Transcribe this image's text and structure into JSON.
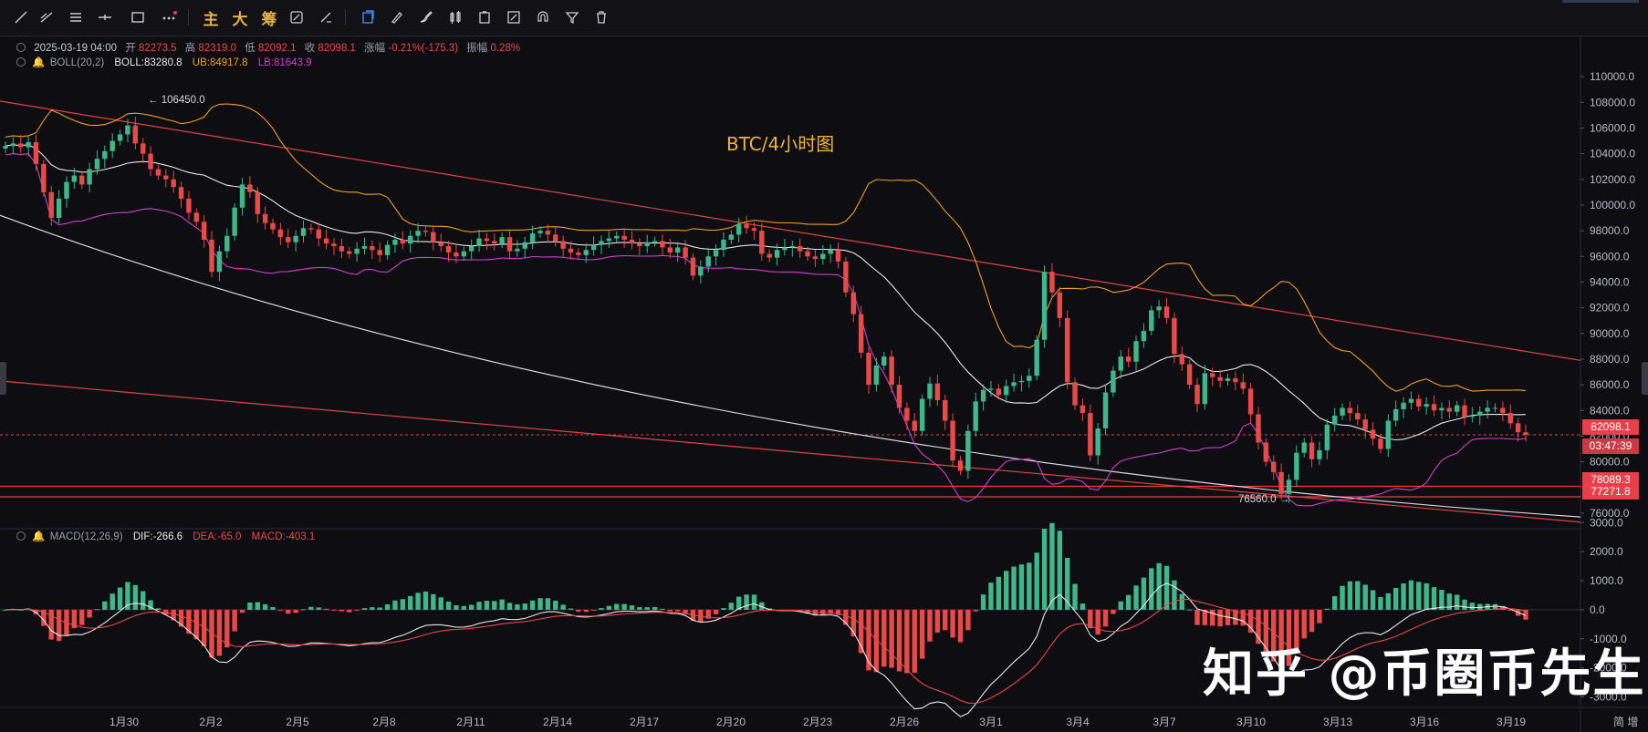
{
  "toolbar": {
    "tools": [
      {
        "name": "trend-line-icon",
        "glyph": "line"
      },
      {
        "name": "horizontal-ray-icon",
        "glyph": "hray"
      },
      {
        "name": "parallel-channel-icon",
        "glyph": "lines"
      },
      {
        "name": "horizontal-line-icon",
        "glyph": "hline"
      },
      {
        "name": "rectangle-icon",
        "glyph": "rect"
      },
      {
        "name": "more-icon",
        "glyph": "more"
      }
    ],
    "cjk_tools": [
      "主",
      "大",
      "筹"
    ]
  },
  "info": {
    "datetime": "2025-03-19 04:00",
    "open_label": "开",
    "open": "82273.5",
    "high_label": "高",
    "high": "82319.0",
    "low_label": "低",
    "low": "82092.1",
    "close_label": "收",
    "close": "82098.1",
    "change_label": "涨幅",
    "change": "-0.21%(-175.3)",
    "amplitude_label": "振幅",
    "amplitude": "0.28%"
  },
  "boll": {
    "name": "BOLL(20,2)",
    "mid_label": "BOLL:",
    "mid": "83280.8",
    "ub_label": "UB:",
    "ub": "84917.8",
    "lb_label": "LB:",
    "lb": "81643.9"
  },
  "macd": {
    "name": "MACD(12,26,9)",
    "dif_label": "DIF:",
    "dif": "-266.6",
    "dea_label": "DEA:",
    "dea": "-65.0",
    "macd_label": "MACD:",
    "macd": "-403.1"
  },
  "chart_title": "BTC/4小时图",
  "high_marker": "← 106450.0",
  "low_marker": "76560.0 →",
  "tags": {
    "last_price": "82098.1",
    "countdown": "03:47:39",
    "support1": "78089.3",
    "support2": "77271.8"
  },
  "watermark": "知乎 @币圈币先生",
  "corner_label": "简 增",
  "colors": {
    "up": "#3fb68b",
    "down": "#e84a4a",
    "boll_mid": "#e8e8e8",
    "boll_ub": "#f0a020",
    "boll_lb": "#d040d0",
    "trendline": "#e04545",
    "title": "#f0b43c",
    "tag_red": "#e8404a"
  },
  "chart_data": {
    "type": "candlestick",
    "title": "BTC/4小时图",
    "price_axis": {
      "ticks": [
        110000,
        108000,
        106000,
        104000,
        102000,
        100000,
        98000,
        96000,
        94000,
        92000,
        90000,
        88000,
        86000,
        84000,
        82000,
        80000,
        78000,
        76000
      ],
      "range": [
        75000,
        111500
      ]
    },
    "macd_axis": {
      "ticks": [
        3000,
        2000,
        1000,
        0,
        -1000,
        -2000,
        -3000
      ],
      "range": [
        -3300,
        3200
      ]
    },
    "x_ticks": [
      "1月30",
      "2月2",
      "2月5",
      "2月8",
      "2月11",
      "2月14",
      "2月17",
      "2月20",
      "2月23",
      "2月26",
      "3月1",
      "3月4",
      "3月7",
      "3月10",
      "3月13",
      "3月16",
      "3月19"
    ],
    "series_close": [
      104600,
      104800,
      104500,
      104900,
      103200,
      101000,
      99000,
      100500,
      101800,
      102300,
      101600,
      102800,
      103600,
      104200,
      105000,
      105500,
      106200,
      104800,
      104000,
      102800,
      102300,
      102000,
      101400,
      100500,
      99400,
      98700,
      97300,
      94800,
      96400,
      97600,
      99800,
      101600,
      101000,
      99300,
      98600,
      98100,
      97500,
      97100,
      97600,
      98200,
      98100,
      97400,
      97000,
      96800,
      96400,
      96200,
      96600,
      96800,
      96500,
      96100,
      96900,
      97300,
      97000,
      97600,
      98000,
      97900,
      97100,
      96800,
      96300,
      96000,
      96400,
      96800,
      97400,
      97200,
      97000,
      97500,
      96400,
      96600,
      97100,
      97800,
      98000,
      97700,
      97200,
      96600,
      96300,
      96100,
      96500,
      96900,
      97200,
      97400,
      97600,
      97300,
      97000,
      96800,
      97100,
      97200,
      96700,
      96300,
      96700,
      95900,
      94500,
      95200,
      96000,
      96500,
      97300,
      97700,
      98500,
      98200,
      98000,
      96200,
      95900,
      96500,
      96700,
      96800,
      96400,
      96000,
      95800,
      96200,
      96500,
      95600,
      93200,
      91500,
      88500,
      86000,
      87500,
      88200,
      86000,
      84200,
      83200,
      82400,
      84900,
      86100,
      84800,
      83200,
      80100,
      79300,
      82400,
      84700,
      85600,
      85700,
      85200,
      85900,
      86200,
      86300,
      86700,
      89500,
      94800,
      93200,
      91200,
      86200,
      84400,
      83800,
      80500,
      82600,
      85400,
      87100,
      88200,
      87800,
      89400,
      90200,
      91800,
      92100,
      91200,
      88400,
      87600,
      86000,
      84500,
      86900,
      86600,
      86300,
      86500,
      86200,
      85700,
      83700,
      81500,
      80000,
      79200,
      77500,
      78600,
      80700,
      81500,
      80200,
      80900,
      82900,
      83600,
      84200,
      83800,
      83300,
      82500,
      81800,
      81000,
      83200,
      84100,
      84600,
      84900,
      84300,
      84500,
      84000,
      84200,
      83900,
      84400,
      83500,
      83600,
      83900,
      84200,
      84200,
      83800,
      83000,
      82300,
      82098
    ]
  }
}
